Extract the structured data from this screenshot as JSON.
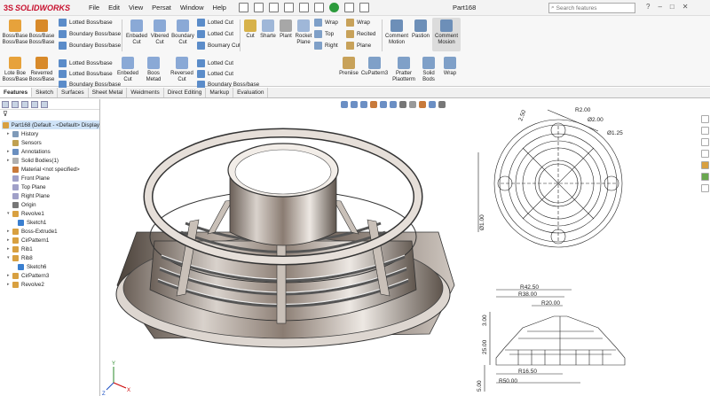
{
  "app": {
    "brand_prefix": "3S",
    "brand": "SOLIDWORKS",
    "doc_title": "Part168"
  },
  "menu": [
    "File",
    "Edit",
    "View",
    "Persat",
    "Window",
    "Help"
  ],
  "search": {
    "placeholder": "Search features"
  },
  "ribbon": {
    "row1": {
      "boss_base_1": "Boss/Base Boss/Base",
      "boss_base_2": "Boss/Base Boss/Base",
      "lotted_boss_base": "Lotted Boss/base",
      "boundary_boss_base_1": "Boundary Boss/base",
      "boundary_boss_base_2": "Boundary Boss/base",
      "enbaded_cut": "Enbaded Cut",
      "vibered_cut": "Vibered Cut",
      "boundary_cut": "Boundary Cut",
      "lotted_cut_1": "Lotted Cut",
      "lotted_cut_2": "Lotted Cut",
      "boumary_cut": "Boumary Cut",
      "cut": "Cut",
      "sharte": "Sharte",
      "plant": "Plant",
      "rocket_plane": "Rocket Plane",
      "wrap_1": "Wrap",
      "top": "Top",
      "right": "Right",
      "wrap_2": "Wrap",
      "recited": "Recited",
      "plane": "Plane",
      "comment_motion": "Comment Motion",
      "pastion": "Pastion",
      "comment_mosion": "Comment Mosion"
    },
    "row2": {
      "lote_boe_boss_base": "Lote Boe Boss/Base",
      "reverred_boss_base": "Reverred Boss/Base",
      "lotted_boss_base": "Lotted Boss/base",
      "lotted_boss_base_2": "Lotted Boss/base",
      "boundary_boss_base": "Boundary Boss/base",
      "enbeded_cut": "Enbeded Cut",
      "boos_metad": "Boos Metad",
      "reversed_cut": "Reversed Cut",
      "lotted_cut_1": "Lotted Cut",
      "lotted_cut_2": "Lotted Cut",
      "boundary_boss_base_2": "Boundary Boss/base",
      "preniise": "Preniise",
      "cupattern3": "CuPattern3",
      "pratter_plaotterm": "Pratter Plaotterm",
      "solid_bods": "Solid Bods",
      "wrap": "Wrap"
    }
  },
  "tabs": [
    "Features",
    "Sketch",
    "Surfaces",
    "Sheet Metal",
    "Weidments",
    "Direct Editing",
    "Markup",
    "Evaluation"
  ],
  "tree": [
    {
      "label": "Part168  (Default - <Default> Display",
      "level": 0,
      "arrow": ""
    },
    {
      "label": "History",
      "level": 1,
      "arrow": "▸"
    },
    {
      "label": "Sensors",
      "level": 1,
      "arrow": ""
    },
    {
      "label": "Annotations",
      "level": 1,
      "arrow": "▸"
    },
    {
      "label": "Solid Bodies(1)",
      "level": 1,
      "arrow": "▸"
    },
    {
      "label": "Material <not specified>",
      "level": 1,
      "arrow": ""
    },
    {
      "label": "Front Plane",
      "level": 1,
      "arrow": ""
    },
    {
      "label": "Top Plane",
      "level": 1,
      "arrow": ""
    },
    {
      "label": "Right Plane",
      "level": 1,
      "arrow": ""
    },
    {
      "label": "Origin",
      "level": 1,
      "arrow": ""
    },
    {
      "label": "Revolve1",
      "level": 1,
      "arrow": "▾"
    },
    {
      "label": "Sketch1",
      "level": 2,
      "arrow": ""
    },
    {
      "label": "Boss-Extrude1",
      "level": 1,
      "arrow": "▸"
    },
    {
      "label": "CirPattern1",
      "level": 1,
      "arrow": "▸"
    },
    {
      "label": "Rib1",
      "level": 1,
      "arrow": "▸"
    },
    {
      "label": "Rib8",
      "level": 1,
      "arrow": "▾"
    },
    {
      "label": "Sketch6",
      "level": 2,
      "arrow": ""
    },
    {
      "label": "CirPattern3",
      "level": 1,
      "arrow": "▸"
    },
    {
      "label": "Revolve2",
      "level": 1,
      "arrow": "▸"
    }
  ],
  "dimensions": {
    "top_view": {
      "d1": "2.50",
      "d2": "R2.00",
      "d3": "Ø2.00",
      "d4": "Ø1.25",
      "d5": "Ø1.00"
    },
    "section_view": {
      "r1": "R42.50",
      "r2": "R38.00",
      "r3": "R20.00",
      "v1": "3.00",
      "v2": "25.00",
      "v3": "5.00",
      "r4": "R16.50",
      "r5": "R50.00"
    }
  },
  "triad": {
    "x": "X",
    "y": "Y",
    "z": "Z"
  }
}
